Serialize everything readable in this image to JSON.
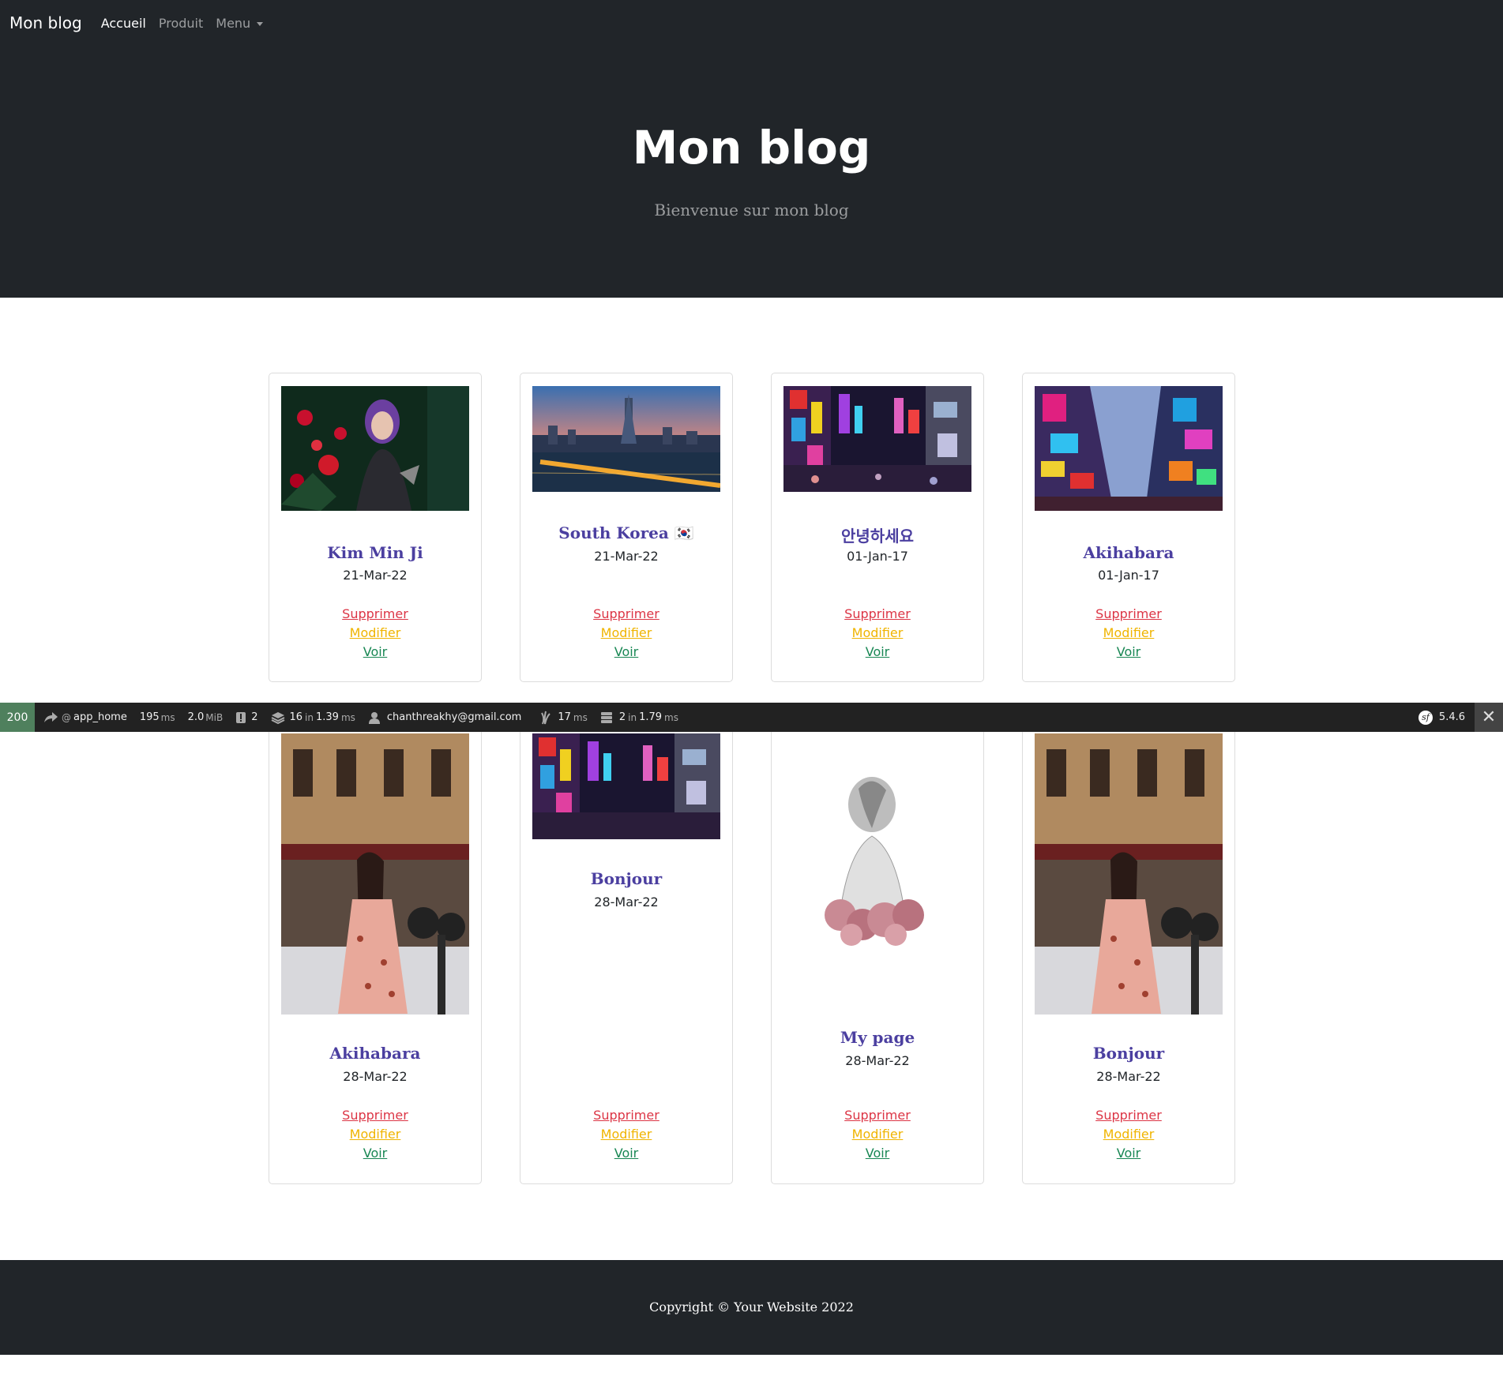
{
  "navbar": {
    "brand": "Mon blog",
    "links": [
      {
        "label": "Accueil"
      },
      {
        "label": "Produit"
      },
      {
        "label": "Menu"
      }
    ]
  },
  "hero": {
    "title": "Mon blog",
    "subtitle": "Bienvenue sur mon blog"
  },
  "card_actions": {
    "delete": "Supprimer",
    "edit": "Modifier",
    "view": "Voir"
  },
  "cards": [
    {
      "title": "Kim Min Ji",
      "date": "21-Mar-22",
      "image": "portrait-roses-image"
    },
    {
      "title": "South Korea 🇰🇷",
      "date": "21-Mar-22",
      "image": "seoul-skyline-image"
    },
    {
      "title": "안녕하세요",
      "date": "01-Jan-17",
      "image": "neon-street-image"
    },
    {
      "title": "Akihabara",
      "date": "01-Jan-17",
      "image": "akihabara-street-image"
    },
    {
      "title": "Akihabara",
      "date": "28-Mar-22",
      "image": "woman-street-image"
    },
    {
      "title": "Bonjour",
      "date": "28-Mar-22",
      "image": "neon-street-image"
    },
    {
      "title": "My page",
      "date": "28-Mar-22",
      "image": "sketch-flowers-image"
    },
    {
      "title": "Bonjour",
      "date": "28-Mar-22",
      "image": "woman-street-image"
    }
  ],
  "toolbar": {
    "status": "200",
    "route": "app_home",
    "time_value": "195",
    "time_unit": "ms",
    "memory_value": "2.0",
    "memory_unit": "MiB",
    "logs": "2",
    "cache_count": "16",
    "cache_in": "in",
    "cache_time": "1.39",
    "cache_unit": "ms",
    "user": "chanthreakhy@gmail.com",
    "twig_time": "17",
    "twig_unit": "ms",
    "db_count": "2",
    "db_in": "in",
    "db_time": "1.79",
    "db_unit": "ms",
    "version": "5.4.6"
  },
  "footer": {
    "text": "Copyright © Your Website 2022"
  },
  "colors": {
    "dark": "#212529",
    "title": "#4b3fa0",
    "danger": "#dc3545",
    "warning": "#f0b400",
    "success": "#198754",
    "toolbar_status": "#4f805d"
  }
}
